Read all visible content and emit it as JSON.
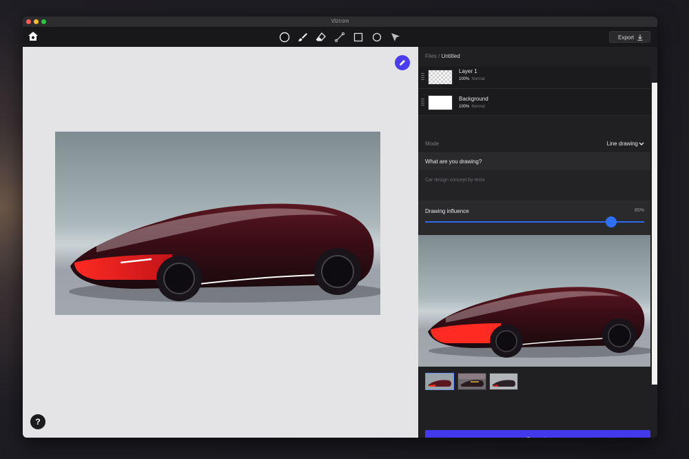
{
  "window": {
    "title": "Vizcom"
  },
  "toolbar": {
    "tools": [
      {
        "name": "brush-size-tool",
        "icon": "circle-filled-icon"
      },
      {
        "name": "brush-tool",
        "icon": "brush-icon"
      },
      {
        "name": "eraser-tool",
        "icon": "eraser-icon"
      },
      {
        "name": "line-tool",
        "icon": "line-icon"
      },
      {
        "name": "rectangle-tool",
        "icon": "square-icon"
      },
      {
        "name": "ellipse-tool",
        "icon": "circle-icon"
      },
      {
        "name": "select-tool",
        "icon": "arrow-pointer-icon"
      }
    ],
    "export_label": "Export"
  },
  "breadcrumb": {
    "root": "Files",
    "separator": " / ",
    "current": "Untitled"
  },
  "layers": [
    {
      "name": "Layer 1",
      "opacity": "100%",
      "blend": "Normal"
    },
    {
      "name": "Background",
      "opacity": "100%",
      "blend": "Normal"
    }
  ],
  "mode": {
    "label": "Mode",
    "value": "Line drawing"
  },
  "prompt": {
    "heading": "What are you drawing?",
    "text": "Car design concept by tesla"
  },
  "influence": {
    "label": "Drawing influence",
    "value_text": "85%",
    "value": 0.85
  },
  "generate_label": "Generate",
  "help_label": "?",
  "colors": {
    "accent": "#4339ec",
    "slider": "#2f6ff3",
    "panel": "#202022"
  }
}
